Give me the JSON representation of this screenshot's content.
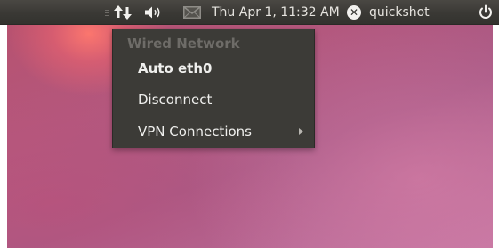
{
  "panel": {
    "network_icon": "network-updown-arrows-icon",
    "volume_icon": "speaker-volume-icon",
    "mail_icon": "envelope-icon",
    "clock": "Thu Apr  1, 11:32 AM",
    "user_icon": "user-status-x-icon",
    "user_name": "quickshot",
    "power_icon": "power-icon"
  },
  "network_menu": {
    "header": "Wired Network",
    "items": [
      {
        "label": "Auto eth0",
        "active": true
      },
      {
        "label": "Disconnect"
      },
      {
        "label": "VPN Connections",
        "has_submenu": true
      }
    ]
  },
  "colors": {
    "panel_bg": "#3a3935",
    "menu_bg": "#3c3b37",
    "menu_text": "#efefed",
    "header_text": "#6e6c68",
    "wallpaper": "#b3587e"
  }
}
